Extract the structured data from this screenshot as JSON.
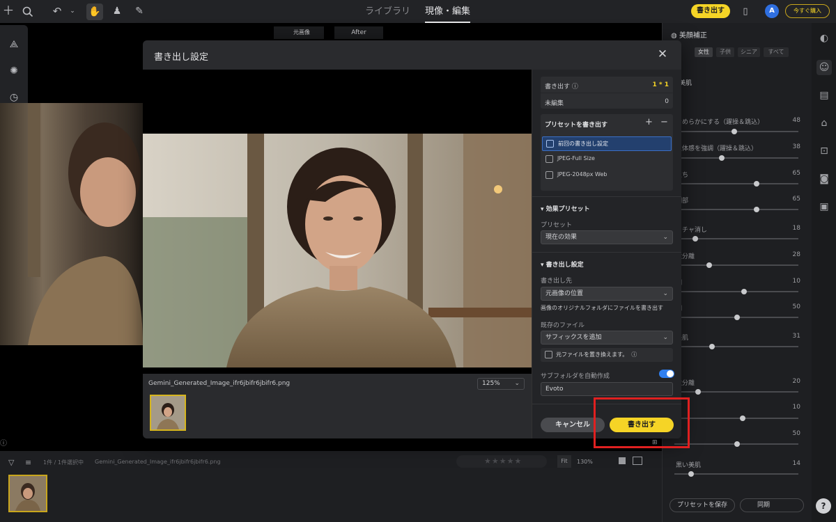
{
  "topbar": {
    "tabs": [
      {
        "label": "ライブラリ",
        "active": false
      },
      {
        "label": "現像・編集",
        "active": true
      }
    ],
    "export_button": "書き出す",
    "avatar_letter": "A",
    "buy_button": "今すぐ購入"
  },
  "canvas": {
    "compare_select": "元画像",
    "after_label": "After"
  },
  "dialog": {
    "title": "書き出し設定",
    "filename": "Gemini_Generated_Image_ifr6jbifr6jbifr6.png",
    "zoom": "125%",
    "export_count_label": "書き出す",
    "export_count_value": "1 * 1",
    "unedited_label": "未編集",
    "unedited_value": "0",
    "presets_header": "プリセットを書き出す",
    "presets": [
      {
        "label": "前回の書き出し設定",
        "selected": true
      },
      {
        "label": "JPEG-Full Size",
        "selected": false
      },
      {
        "label": "JPEG-2048px Web",
        "selected": false
      }
    ],
    "effect_section": "効果プリセット",
    "effect_label": "プリセット",
    "effect_value": "現在の効果",
    "export_section": "書き出し設定",
    "dest_label": "書き出し先",
    "dest_value": "元画像の位置",
    "dest_desc": "画像のオリジナルフォルダにファイルを書き出す",
    "existing_label": "既存のファイル",
    "existing_value": "サフィックスを追加",
    "overwrite_label": "元ファイルを置き換えます。",
    "subfolder_label": "サブフォルダを自動作成",
    "subfolder_value": "Evoto",
    "cancel_button": "キャンセル",
    "export_button": "書き出す"
  },
  "rightpanel": {
    "title": "美顔補正",
    "chips": [
      "女性",
      "子供",
      "シニア",
      "すべて"
    ],
    "section_skin": "美肌",
    "rows": [
      {
        "label": "なめらかにする（躍操＆跳込）",
        "value": "48"
      },
      {
        "label": "立体感を強調（躍操＆跳込）",
        "value": "38"
      },
      {
        "label": "立ち",
        "value": "65"
      },
      {
        "label": "細部",
        "value": "65"
      },
      {
        "label": "スチャ消し",
        "value": "18"
      },
      {
        "label": "数分離",
        "value": "28"
      },
      {
        "label": "調",
        "value": "10"
      },
      {
        "label": "調",
        "value": "50"
      },
      {
        "label": "美肌",
        "value": "31"
      },
      {
        "label": "数分離",
        "value": "20"
      },
      {
        "label": "",
        "value": "10"
      },
      {
        "label": "",
        "value": "50"
      },
      {
        "label": "黒い美肌",
        "value": "14"
      }
    ],
    "save_preset": "プリセットを保存",
    "sync": "同期"
  },
  "bottombar": {
    "count_text": "1件 / 1件選択中",
    "filename": "Gemini_Generated_Image_ifr6jbifr6jbifr6.png",
    "fit_label": "Fit",
    "zoom": "130%"
  },
  "colors": {
    "accent_yellow": "#f5d426",
    "highlight_red": "#e02020",
    "toggle_blue": "#2f7ff0",
    "preset_selected": "#23406e"
  },
  "icons": [
    "plus-icon",
    "search-icon",
    "undo-icon",
    "hand-icon",
    "stamp-icon",
    "pen-icon",
    "close-icon",
    "help-icon"
  ]
}
